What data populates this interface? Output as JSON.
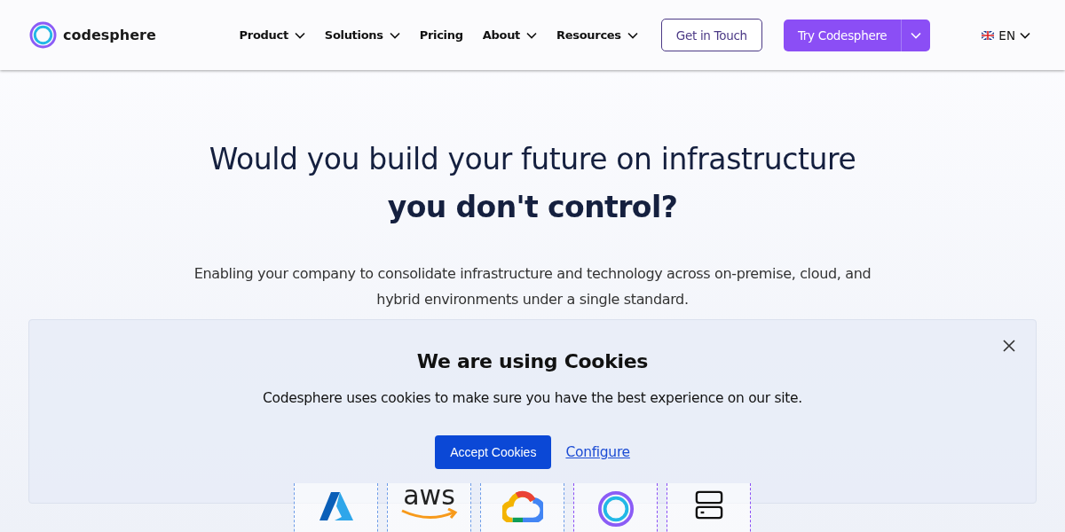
{
  "header": {
    "brand": "codesphere",
    "nav": [
      {
        "label": "Product",
        "dropdown": true
      },
      {
        "label": "Solutions",
        "dropdown": true
      },
      {
        "label": "Pricing",
        "dropdown": false
      },
      {
        "label": "About",
        "dropdown": true
      },
      {
        "label": "Resources",
        "dropdown": true
      }
    ],
    "contact_button": "Get in Touch",
    "try_button": "Try Codesphere",
    "language": "EN"
  },
  "hero": {
    "headline_line1": "Would you build your future on infrastructure",
    "headline_line2": "you don't control?",
    "subtitle": "Enabling your company to consolidate infrastructure and technology across on-premise, cloud, and hybrid environments under a single standard."
  },
  "providers": [
    {
      "kind": "azure"
    },
    {
      "kind": "aws",
      "label": "aws"
    },
    {
      "kind": "gcloud"
    },
    {
      "kind": "codesphere"
    },
    {
      "kind": "server"
    }
  ],
  "cookie_banner": {
    "title": "We are using Cookies",
    "text": "Codesphere uses cookies to make sure you have the best experience on our site.",
    "accept_button": "Accept Cookies",
    "configure_link": "Configure"
  }
}
